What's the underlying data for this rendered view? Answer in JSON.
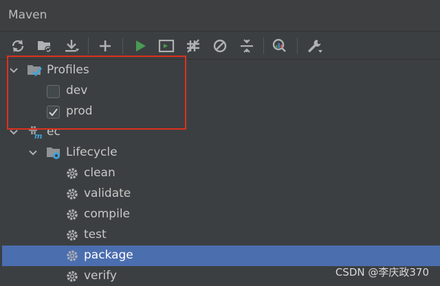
{
  "window": {
    "title": "Maven"
  },
  "toolbar": {
    "buttons": [
      {
        "name": "reload-all",
        "icon": "reload-icon"
      },
      {
        "name": "add-project",
        "icon": "folder-refresh-icon"
      },
      {
        "name": "download",
        "icon": "download-icon"
      },
      {
        "name": "add",
        "icon": "plus-icon"
      },
      {
        "name": "run",
        "icon": "run-icon"
      },
      {
        "name": "execute-goal",
        "icon": "terminal-icon"
      },
      {
        "name": "toggle-offline",
        "icon": "toggle-offline-icon"
      },
      {
        "name": "skip-tests",
        "icon": "skip-tests-icon"
      },
      {
        "name": "collapse-all",
        "icon": "collapse-icon"
      },
      {
        "name": "analyze-dependencies",
        "icon": "analyze-icon"
      },
      {
        "name": "settings",
        "icon": "wrench-icon"
      }
    ]
  },
  "tree": {
    "profiles": {
      "label": "Profiles",
      "items": [
        {
          "label": "dev",
          "checked": false
        },
        {
          "label": "prod",
          "checked": true
        }
      ]
    },
    "project": {
      "label": "ec"
    },
    "lifecycle": {
      "label": "Lifecycle",
      "goals": [
        "clean",
        "validate",
        "compile",
        "test",
        "package",
        "verify"
      ],
      "selected": "package"
    }
  },
  "watermark": "CSDN @李庆政370",
  "colors": {
    "background": "#3c3f41",
    "selection": "#4b6eaf",
    "run_green": "#499c54",
    "highlight_box": "#e0301e"
  }
}
